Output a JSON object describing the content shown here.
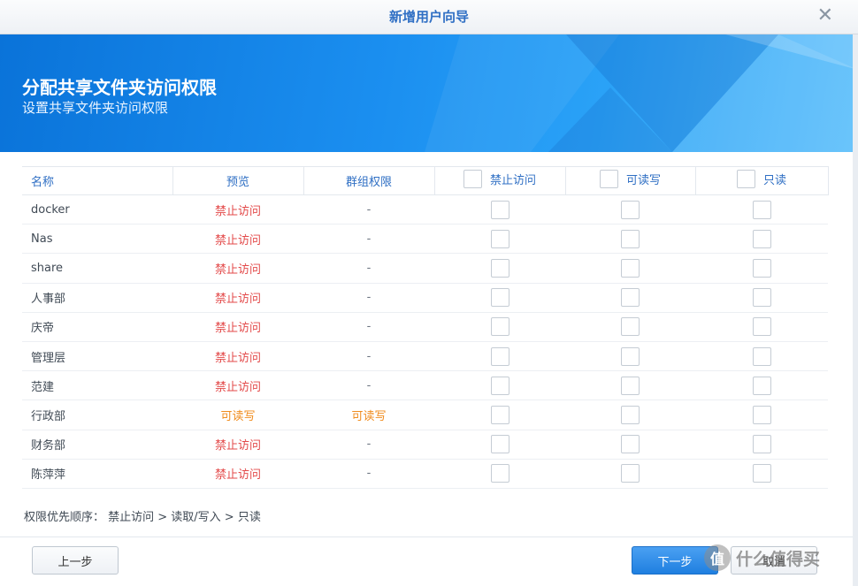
{
  "window": {
    "title": "新增用户向导"
  },
  "banner": {
    "title": "分配共享文件夹访问权限",
    "subtitle": "设置共享文件夹访问权限"
  },
  "table": {
    "headers": {
      "name": "名称",
      "preview": "预览",
      "group": "群组权限",
      "deny": "禁止访问",
      "rw": "可读写",
      "ro": "只读"
    },
    "rows": [
      {
        "name": "docker",
        "preview": "禁止访问",
        "preview_type": "deny",
        "group": "-",
        "group_type": "dash"
      },
      {
        "name": "Nas",
        "preview": "禁止访问",
        "preview_type": "deny",
        "group": "-",
        "group_type": "dash"
      },
      {
        "name": "share",
        "preview": "禁止访问",
        "preview_type": "deny",
        "group": "-",
        "group_type": "dash"
      },
      {
        "name": "人事部",
        "preview": "禁止访问",
        "preview_type": "deny",
        "group": "-",
        "group_type": "dash"
      },
      {
        "name": "庆帝",
        "preview": "禁止访问",
        "preview_type": "deny",
        "group": "-",
        "group_type": "dash"
      },
      {
        "name": "管理层",
        "preview": "禁止访问",
        "preview_type": "deny",
        "group": "-",
        "group_type": "dash"
      },
      {
        "name": "范建",
        "preview": "禁止访问",
        "preview_type": "deny",
        "group": "-",
        "group_type": "dash"
      },
      {
        "name": "行政部",
        "preview": "可读写",
        "preview_type": "rw",
        "group": "可读写",
        "group_type": "rw"
      },
      {
        "name": "财务部",
        "preview": "禁止访问",
        "preview_type": "deny",
        "group": "-",
        "group_type": "dash"
      },
      {
        "name": "陈萍萍",
        "preview": "禁止访问",
        "preview_type": "deny",
        "group": "-",
        "group_type": "dash"
      }
    ]
  },
  "note": "权限优先顺序： 禁止访问 > 读取/写入 > 只读",
  "buttons": {
    "back": "上一步",
    "next": "下一步",
    "cancel": "取消"
  },
  "watermark": {
    "logo": "值",
    "text": "什么值得买"
  },
  "colors": {
    "accent": "#2f6fc4",
    "deny": "#e34a4a",
    "readwrite": "#f08c1e",
    "primary_button": "#1f7fe0"
  },
  "icons": {
    "close": "close-icon"
  }
}
